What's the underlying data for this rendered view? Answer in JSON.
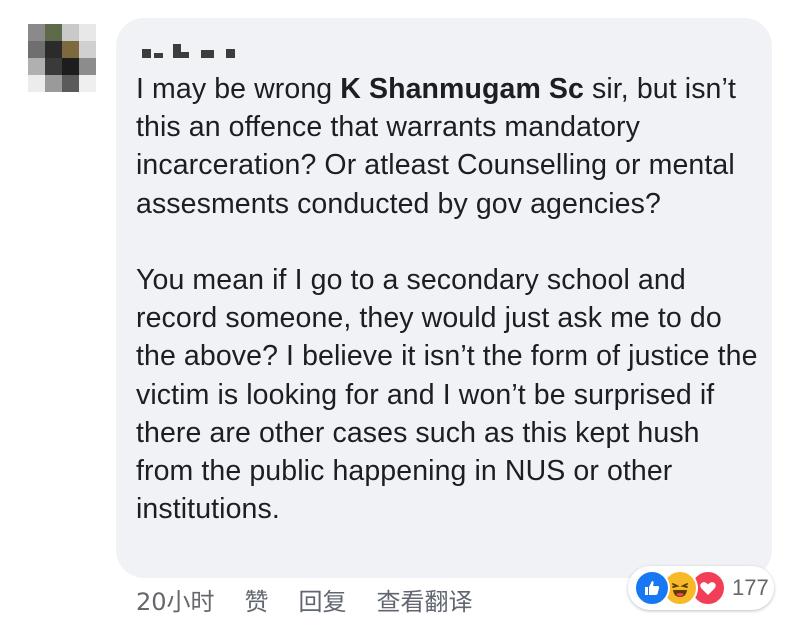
{
  "comment": {
    "paragraph_1_pre": "I may be wrong ",
    "mention": "K Shanmugam Sc",
    "paragraph_1_post": " sir, but isn’t this an offence that warrants mandatory incarceration? Or atleast Counselling or mental assesments conducted by gov agencies?",
    "paragraph_2": "You mean if I go to a secondary school and record someone, they would just ask me to do the above? I believe it isn’t the form of justice the victim is looking for and I won’t be surprised if there are other cases such as this kept hush from the public happening in NUS or other institutions."
  },
  "actions": {
    "timestamp": "20小时",
    "like_label": "赞",
    "reply_label": "回复",
    "translate_label": "查看翻译"
  },
  "reactions": {
    "icons": [
      "like-icon",
      "haha-icon",
      "love-icon"
    ],
    "count": "177",
    "colors": {
      "like": "#1877f2",
      "haha": "#f7b928",
      "love": "#f33e58"
    }
  },
  "colors": {
    "bubble": "#f0f2f5",
    "text": "#1c1e21",
    "meta": "#65676b"
  }
}
